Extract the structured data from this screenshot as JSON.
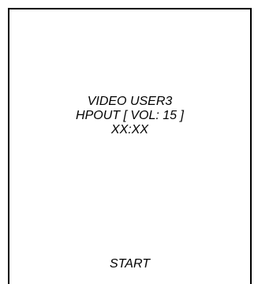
{
  "display": {
    "mode_line": "VIDEO USER3",
    "output_line": "HPOUT [ VOL: 15 ]",
    "time_line": "XX:XX"
  },
  "controls": {
    "start_label": "START"
  }
}
